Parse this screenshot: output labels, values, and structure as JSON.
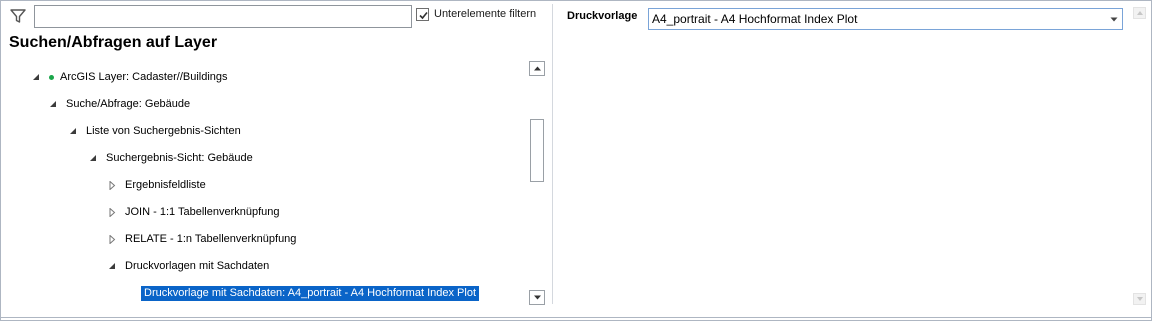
{
  "filter": {
    "input_value": "",
    "checkbox_checked": true,
    "checkbox_label": "Unterelemente filtern"
  },
  "left_pane": {
    "title": "Suchen/Abfragen auf Layer"
  },
  "tree": {
    "items": [
      {
        "label": "ArcGIS Layer: Cadaster//Buildings",
        "state": "expanded",
        "level": 1,
        "has_status_dot": true,
        "selected": false
      },
      {
        "label": "Suche/Abfrage: Gebäude",
        "state": "expanded",
        "level": 2,
        "has_status_dot": false,
        "selected": false
      },
      {
        "label": "Liste von Suchergebnis-Sichten",
        "state": "expanded",
        "level": 3,
        "has_status_dot": false,
        "selected": false
      },
      {
        "label": "Suchergebnis-Sicht: Gebäude",
        "state": "expanded",
        "level": 4,
        "has_status_dot": false,
        "selected": false
      },
      {
        "label": "Ergebnisfeldliste",
        "state": "collapsed",
        "level": 5,
        "has_status_dot": false,
        "selected": false
      },
      {
        "label": "JOIN - 1:1 Tabellenverknüpfung",
        "state": "collapsed",
        "level": 5,
        "has_status_dot": false,
        "selected": false
      },
      {
        "label": "RELATE - 1:n Tabellenverknüpfung",
        "state": "collapsed",
        "level": 5,
        "has_status_dot": false,
        "selected": false
      },
      {
        "label": "Druckvorlagen mit Sachdaten",
        "state": "expanded",
        "level": 5,
        "has_status_dot": false,
        "selected": false
      },
      {
        "label": "Druckvorlage mit Sachdaten: A4_portrait - A4 Hochformat Index Plot",
        "state": "leaf",
        "level": 6,
        "has_status_dot": false,
        "selected": true
      }
    ]
  },
  "right_pane": {
    "property_label": "Druckvorlage",
    "property_value": "A4_portrait - A4 Hochformat Index Plot"
  },
  "colors": {
    "selection": "#0a64c8",
    "status_dot": "#1aa64a",
    "border": "#aeb6c2"
  },
  "icons": {
    "filter": "funnel-icon",
    "expanded": "triangle-down-right-icon",
    "collapsed": "triangle-right-outline-icon",
    "dropdown": "chevron-down-icon",
    "scroll_up": "scroll-up-arrow-icon",
    "scroll_down": "scroll-down-arrow-icon"
  }
}
